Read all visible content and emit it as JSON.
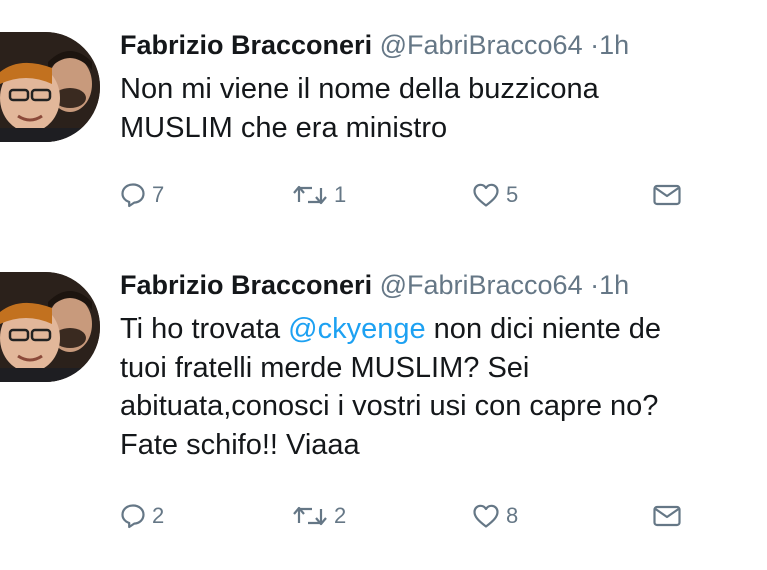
{
  "tweets": [
    {
      "author_name": "Fabrizio Bracconeri",
      "handle": "@FabriBracco64",
      "separator": "·",
      "time": "1h",
      "lines": [
        "Non mi viene il nome della buzzicona",
        "MUSLIM che era ministro"
      ],
      "actions": {
        "reply_icon": "reply-icon",
        "reply_count": "7",
        "retweet_icon": "retweet-icon",
        "retweet_count": "1",
        "like_icon": "heart-icon",
        "like_count": "5",
        "dm_icon": "envelope-icon"
      }
    },
    {
      "author_name": "Fabrizio Bracconeri",
      "handle": "@FabriBracco64",
      "separator": "·",
      "time": "1h",
      "line1_before": "Ti ho trovata ",
      "mention": "@ckyenge",
      "line1_after": " non dici niente de",
      "lines": [
        "tuoi fratelli merde MUSLIM? Sei",
        "abituata,conosci i vostri usi con capre no?",
        "Fate schifo!! Viaaa"
      ],
      "actions": {
        "reply_icon": "reply-icon",
        "reply_count": "2",
        "retweet_icon": "retweet-icon",
        "retweet_count": "2",
        "like_icon": "heart-icon",
        "like_count": "8",
        "dm_icon": "envelope-icon"
      }
    }
  ],
  "colors": {
    "text": "#14171a",
    "secondary": "#657786",
    "mention": "#1da1f2",
    "background": "#ffffff"
  }
}
